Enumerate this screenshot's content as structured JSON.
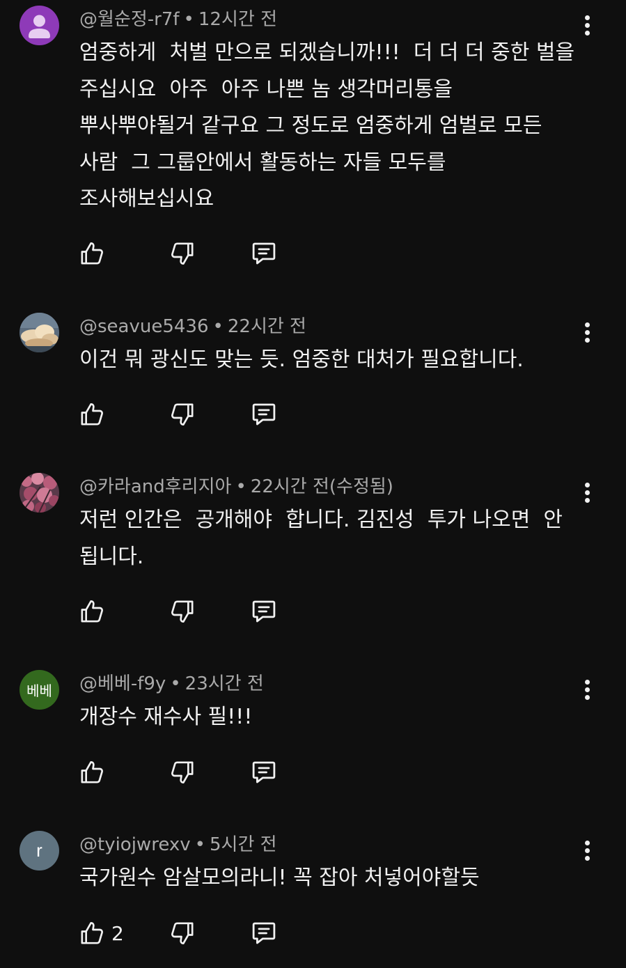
{
  "comments": [
    {
      "handle": "@월순정-r7f",
      "time": "12시간 전",
      "text": "엄중하게  처벌 만으로 되겠습니까!!!  더 더 더 중한 벌을 주십시요  아주  아주 나쁜 놈 생각머리통을 뿌사뿌야될거 같구요 그 정도로 엄중하게 엄벌로 모든 사람  그 그룹안에서 활동하는 자들 모두를 조사해보십시요",
      "lines": [
        "엄중하게  처벌 만으로 되겠습니까!!!  더 더 더 중한 벌을",
        "주십시요  아주  아주 나쁜 놈 생각머리통을",
        "뿌사뿌야될거 같구요 그 정도로 엄중하게 엄벌로 모든",
        "사람  그 그룹안에서 활동하는 자들 모두를",
        "조사해보십시요"
      ],
      "avatar": {
        "type": "default",
        "color": "#8e3ab8",
        "icon": "person-icon"
      },
      "likes": ""
    },
    {
      "handle": "@seavue5436",
      "time": "22시간 전",
      "lines": [
        "이건 뭐 광신도 맞는 듯. 엄중한 대처가 필요합니다."
      ],
      "avatar": {
        "type": "photo",
        "icon": "cloud-photo"
      },
      "likes": ""
    },
    {
      "handle": "@카라and후리지아",
      "time": "22시간 전(수정됨)",
      "lines": [
        "저런 인간은  공개해야  합니다. 김진성  투가 나오면  안",
        "됩니다."
      ],
      "avatar": {
        "type": "photo",
        "icon": "blossom-photo"
      },
      "likes": ""
    },
    {
      "handle": "@베베-f9y",
      "time": "23시간 전",
      "lines": [
        "개장수 재수사 필!!!"
      ],
      "avatar": {
        "type": "initial",
        "initial": "베베",
        "color": "#33691e"
      },
      "likes": ""
    },
    {
      "handle": "@tyiojwrexv",
      "time": "5시간 전",
      "lines": [
        "국가원수 암살모의라니! 꼭 잡아 처넣어야할듯"
      ],
      "avatar": {
        "type": "initial",
        "initial": "r",
        "color": "#5f7380"
      },
      "likes": "2"
    }
  ],
  "separator": "•",
  "icons": {
    "like": "thumbs-up-icon",
    "dislike": "thumbs-down-icon",
    "reply": "reply-comment-icon",
    "more": "more-vert-icon"
  },
  "colors": {
    "background": "#0f0f0f",
    "text": "#f1f1f1",
    "meta": "#aaaaaa"
  }
}
